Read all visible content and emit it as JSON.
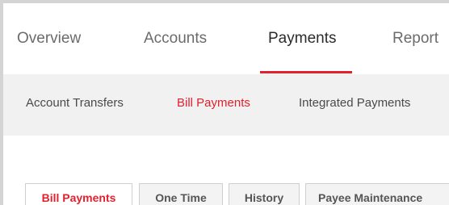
{
  "topnav": {
    "items": [
      {
        "label": "Overview"
      },
      {
        "label": "Accounts"
      },
      {
        "label": "Payments",
        "active": true
      },
      {
        "label": "Report"
      }
    ]
  },
  "subnav": {
    "items": [
      {
        "label": "Account Transfers"
      },
      {
        "label": "Bill Payments",
        "active": true
      },
      {
        "label": "Integrated Payments"
      }
    ]
  },
  "tabs": {
    "items": [
      {
        "label": "Bill Payments",
        "active": true
      },
      {
        "label": "One Time"
      },
      {
        "label": "History"
      },
      {
        "label": "Payee Maintenance"
      }
    ]
  },
  "colors": {
    "accent": "#e4202e",
    "page_background": "#d4d4d4",
    "subnav_background": "#f1f1f1"
  }
}
